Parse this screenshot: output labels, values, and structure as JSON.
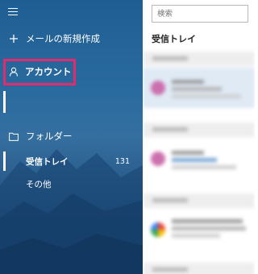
{
  "sidebar": {
    "new_mail_label": "メールの新規作成",
    "account_label": "アカウント",
    "folders_label": "フォルダー",
    "inbox_label": "受信トレイ",
    "inbox_count": "131",
    "other_label": "その他"
  },
  "main": {
    "search_placeholder": "検索",
    "inbox_title": "受信トレイ"
  },
  "colors": {
    "highlight_border": "#e32a6c",
    "avatar_pink": "#cc6fae"
  },
  "icons": [
    "hamburger-menu-icon",
    "plus-icon",
    "person-icon",
    "folder-icon"
  ]
}
